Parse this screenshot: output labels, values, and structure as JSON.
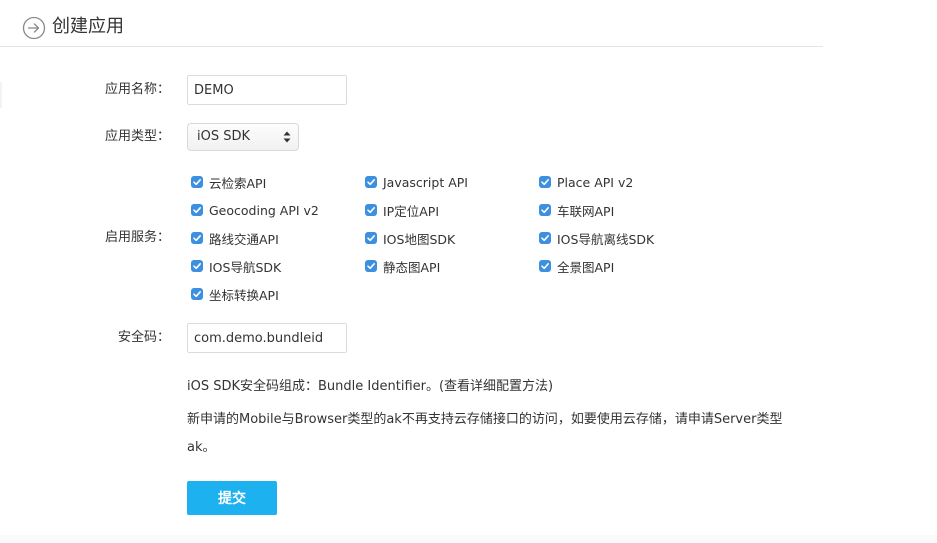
{
  "header": {
    "title": "创建应用",
    "icon": "arrow-right-circle-icon"
  },
  "form": {
    "app_name": {
      "label": "应用名称：",
      "value": "DEMO"
    },
    "app_type": {
      "label": "应用类型：",
      "selected": "iOS SDK"
    },
    "services": {
      "label": "启用服务：",
      "checkbox_color": "#3d8fdf",
      "items": [
        {
          "label": "云检索API",
          "checked": true
        },
        {
          "label": "Javascript API",
          "checked": true
        },
        {
          "label": "Place API v2",
          "checked": true
        },
        {
          "label": "Geocoding API v2",
          "checked": true
        },
        {
          "label": "IP定位API",
          "checked": true
        },
        {
          "label": "车联网API",
          "checked": true
        },
        {
          "label": "路线交通API",
          "checked": true
        },
        {
          "label": "IOS地图SDK",
          "checked": true
        },
        {
          "label": "IOS导航离线SDK",
          "checked": true
        },
        {
          "label": "IOS导航SDK",
          "checked": true
        },
        {
          "label": "静态图API",
          "checked": true
        },
        {
          "label": "全景图API",
          "checked": true
        },
        {
          "label": "坐标转换API",
          "checked": true
        }
      ]
    },
    "security_code": {
      "label": "安全码：",
      "value": "com.demo.bundleid"
    },
    "notes": {
      "line1": "iOS SDK安全码组成：Bundle Identifier。(查看详细配置方法)",
      "line2a": "新申请的Mobile与Browser类型的ak不再支持云存储接口的访问，如要使用云存储，请申请Server类型",
      "line2b": "ak。"
    },
    "submit_label": "提交",
    "submit_color": "#1eb1ef"
  }
}
